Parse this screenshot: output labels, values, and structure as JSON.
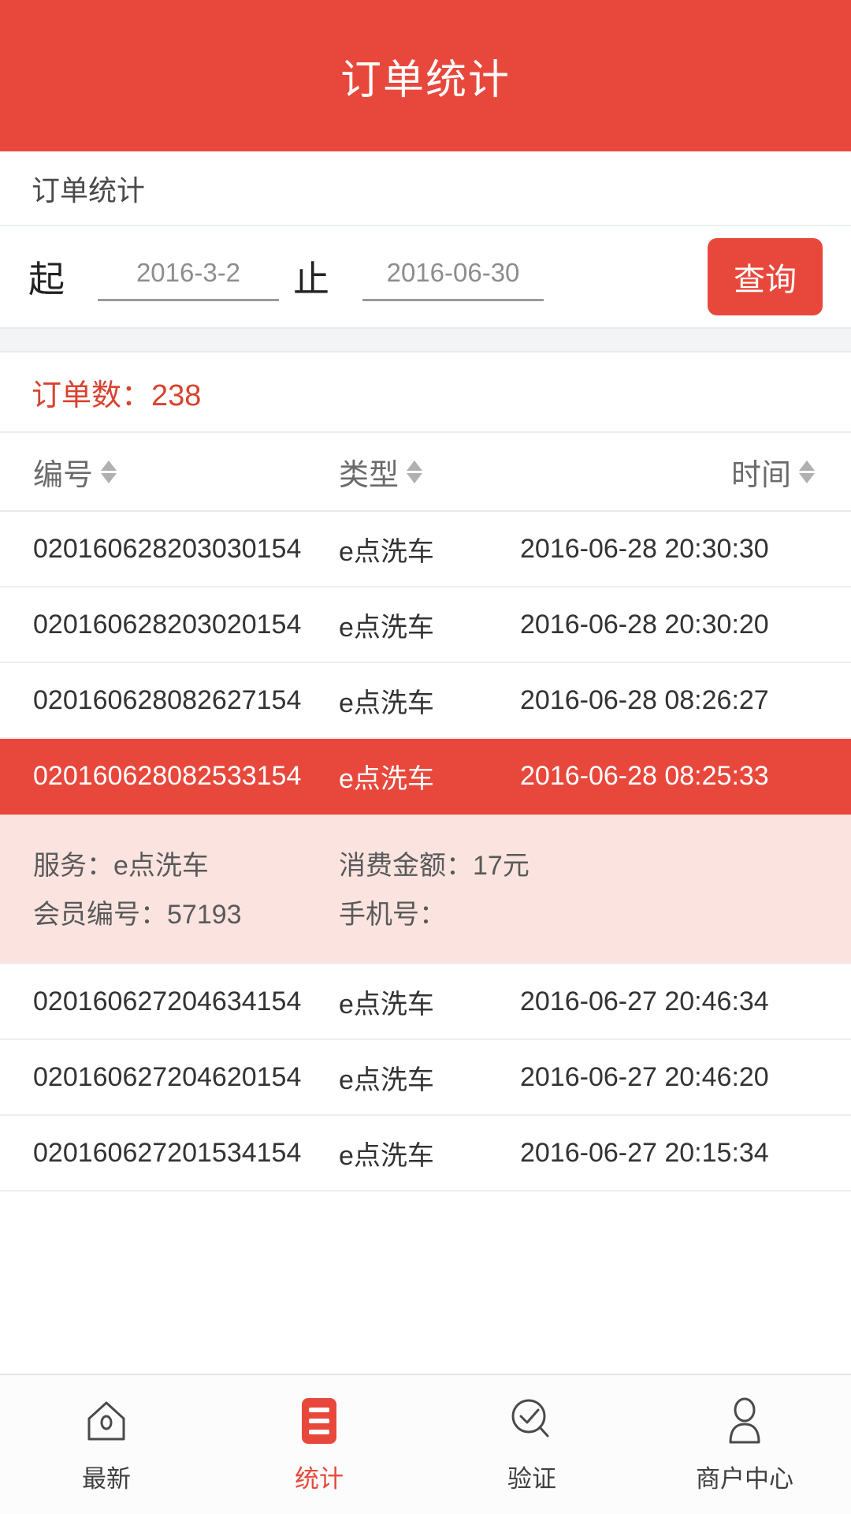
{
  "header": {
    "title": "订单统计"
  },
  "subtitle": {
    "text": "订单统计"
  },
  "filter": {
    "start_label": "起",
    "start_value": "2016-3-2",
    "end_label": "止",
    "end_value": "2016-06-30",
    "query_label": "查询"
  },
  "summary": {
    "count_text": "订单数：238",
    "count": "238"
  },
  "table": {
    "columns": [
      {
        "label": "编号"
      },
      {
        "label": "类型"
      },
      {
        "label": "时间"
      }
    ],
    "rows": [
      {
        "id": "020160628203030154",
        "type": "e点洗车",
        "time": "2016-06-28 20:30:30",
        "selected": false
      },
      {
        "id": "020160628203020154",
        "type": "e点洗车",
        "time": "2016-06-28 20:30:20",
        "selected": false
      },
      {
        "id": "020160628082627154",
        "type": "e点洗车",
        "time": "2016-06-28 08:26:27",
        "selected": false
      },
      {
        "id": "020160628082533154",
        "type": "e点洗车",
        "time": "2016-06-28 08:25:33",
        "selected": true
      },
      {
        "id": "020160627204634154",
        "type": "e点洗车",
        "time": "2016-06-27 20:46:34",
        "selected": false
      },
      {
        "id": "020160627204620154",
        "type": "e点洗车",
        "time": "2016-06-27 20:46:20",
        "selected": false
      },
      {
        "id": "020160627201534154",
        "type": "e点洗车",
        "time": "2016-06-27 20:15:34",
        "selected": false
      }
    ]
  },
  "detail": {
    "service": "服务：e点洗车",
    "amount": "消费金额：17元",
    "member_id": "会员编号：57193",
    "phone": "手机号："
  },
  "tabbar": {
    "items": [
      {
        "label": "最新",
        "icon": "home-icon",
        "active": false
      },
      {
        "label": "统计",
        "icon": "list-icon",
        "active": true
      },
      {
        "label": "验证",
        "icon": "verify-icon",
        "active": false
      },
      {
        "label": "商户中心",
        "icon": "person-icon",
        "active": false
      }
    ]
  },
  "colors": {
    "brand_red": "#e8483c",
    "detail_bg": "#fbe4e0",
    "count_red": "#d9422f"
  }
}
